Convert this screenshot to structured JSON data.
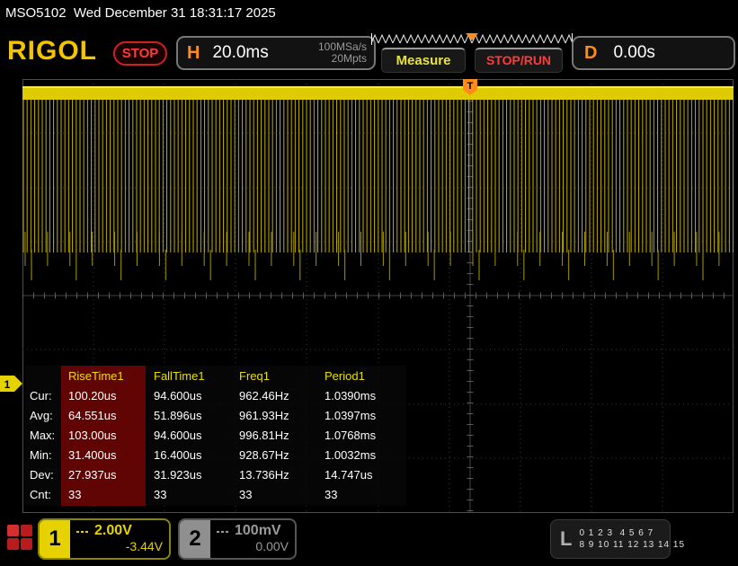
{
  "titlebar": {
    "text": "MSO5102  Wed December 31 18:31:17 2025"
  },
  "toolbar": {
    "logo": "RIGOL",
    "run_state": "STOP",
    "h_label": "H",
    "timebase": "20.0ms",
    "sample_rate": "100MSa/s",
    "mem_depth": "20Mpts",
    "measure_label": "Measure",
    "stoprun_label": "STOP/RUN",
    "d_label": "D",
    "delay": "0.00s"
  },
  "trigger": {
    "flag": "T"
  },
  "channel_marker": "1",
  "measure": {
    "columns": [
      "RiseTime1",
      "FallTime1",
      "Freq1",
      "Period1"
    ],
    "rows": [
      {
        "label": "Cur:",
        "values": [
          "100.20us",
          "94.600us",
          "962.46Hz",
          "1.0390ms"
        ]
      },
      {
        "label": "Avg:",
        "values": [
          "64.551us",
          "51.896us",
          "961.93Hz",
          "1.0397ms"
        ]
      },
      {
        "label": "Max:",
        "values": [
          "103.00us",
          "94.600us",
          "996.81Hz",
          "1.0768ms"
        ]
      },
      {
        "label": "Min:",
        "values": [
          "31.400us",
          "16.400us",
          "928.67Hz",
          "1.0032ms"
        ]
      },
      {
        "label": "Dev:",
        "values": [
          "27.937us",
          "31.923us",
          "13.736Hz",
          "14.747us"
        ]
      },
      {
        "label": "Cnt:",
        "values": [
          "33",
          "33",
          "33",
          "33"
        ]
      }
    ]
  },
  "bottombar": {
    "ch1": {
      "number": "1",
      "scale": "2.00V",
      "offset": "-3.44V"
    },
    "ch2": {
      "number": "2",
      "scale": "100mV",
      "offset": "0.00V"
    },
    "logic": {
      "label": "L",
      "row1": "0 1 2 3  4 5 6 7",
      "row2": "8 9 10 11 12 13 14 15"
    }
  },
  "colors": {
    "channel1_yellow": "#e6d200",
    "accent_orange": "#ff8c1a",
    "status_red": "#ff3b3b",
    "header_yellow": "#e8e000",
    "highlight_dark_red": "#600404"
  }
}
